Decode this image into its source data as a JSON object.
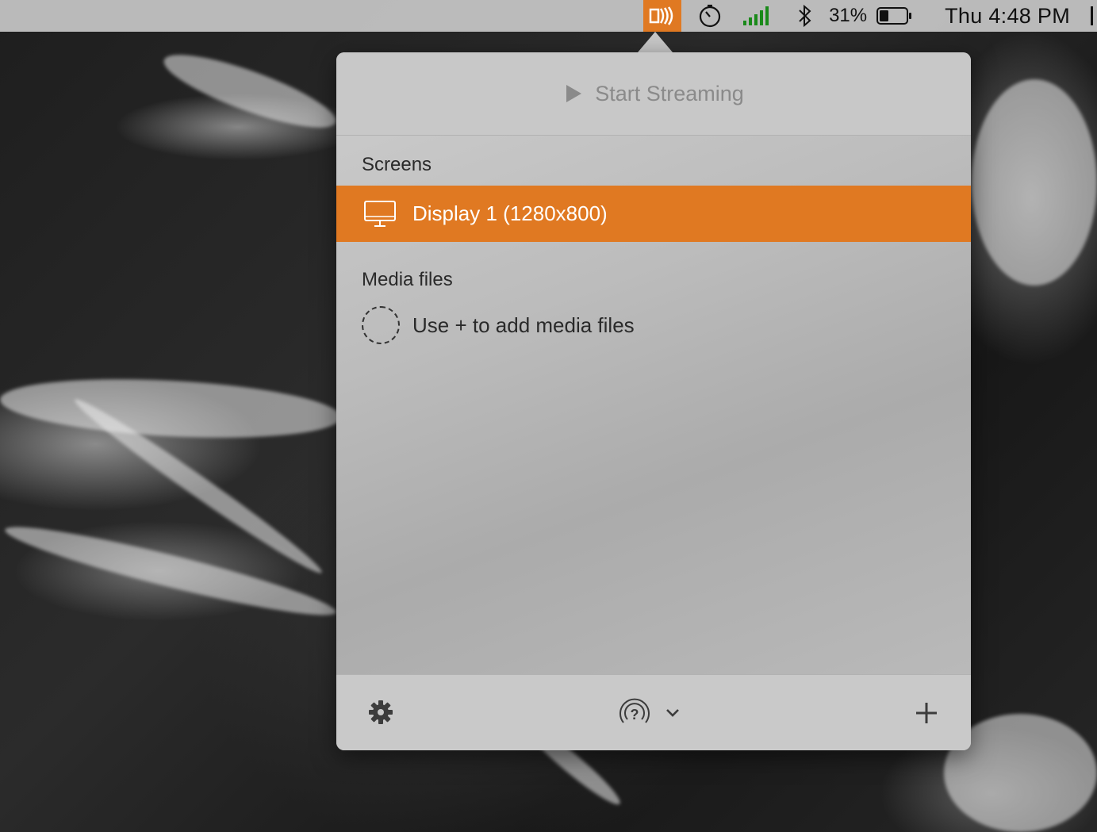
{
  "menubar": {
    "battery_percent": "31%",
    "clock": "Thu 4:48 PM",
    "app_icon": "stream-waves-icon",
    "accent_color": "#e07922"
  },
  "panel": {
    "header": {
      "start_label": "Start Streaming",
      "play_icon": "play-icon"
    },
    "screens": {
      "section_label": "Screens",
      "items": [
        {
          "label": "Display 1 (1280x800)",
          "icon": "monitor-icon",
          "selected": true
        }
      ]
    },
    "media": {
      "section_label": "Media files",
      "empty_hint": "Use + to add media files"
    },
    "footer": {
      "settings_icon": "gear-icon",
      "device_icon": "airplay-unknown-icon",
      "add_icon": "plus-icon"
    }
  }
}
